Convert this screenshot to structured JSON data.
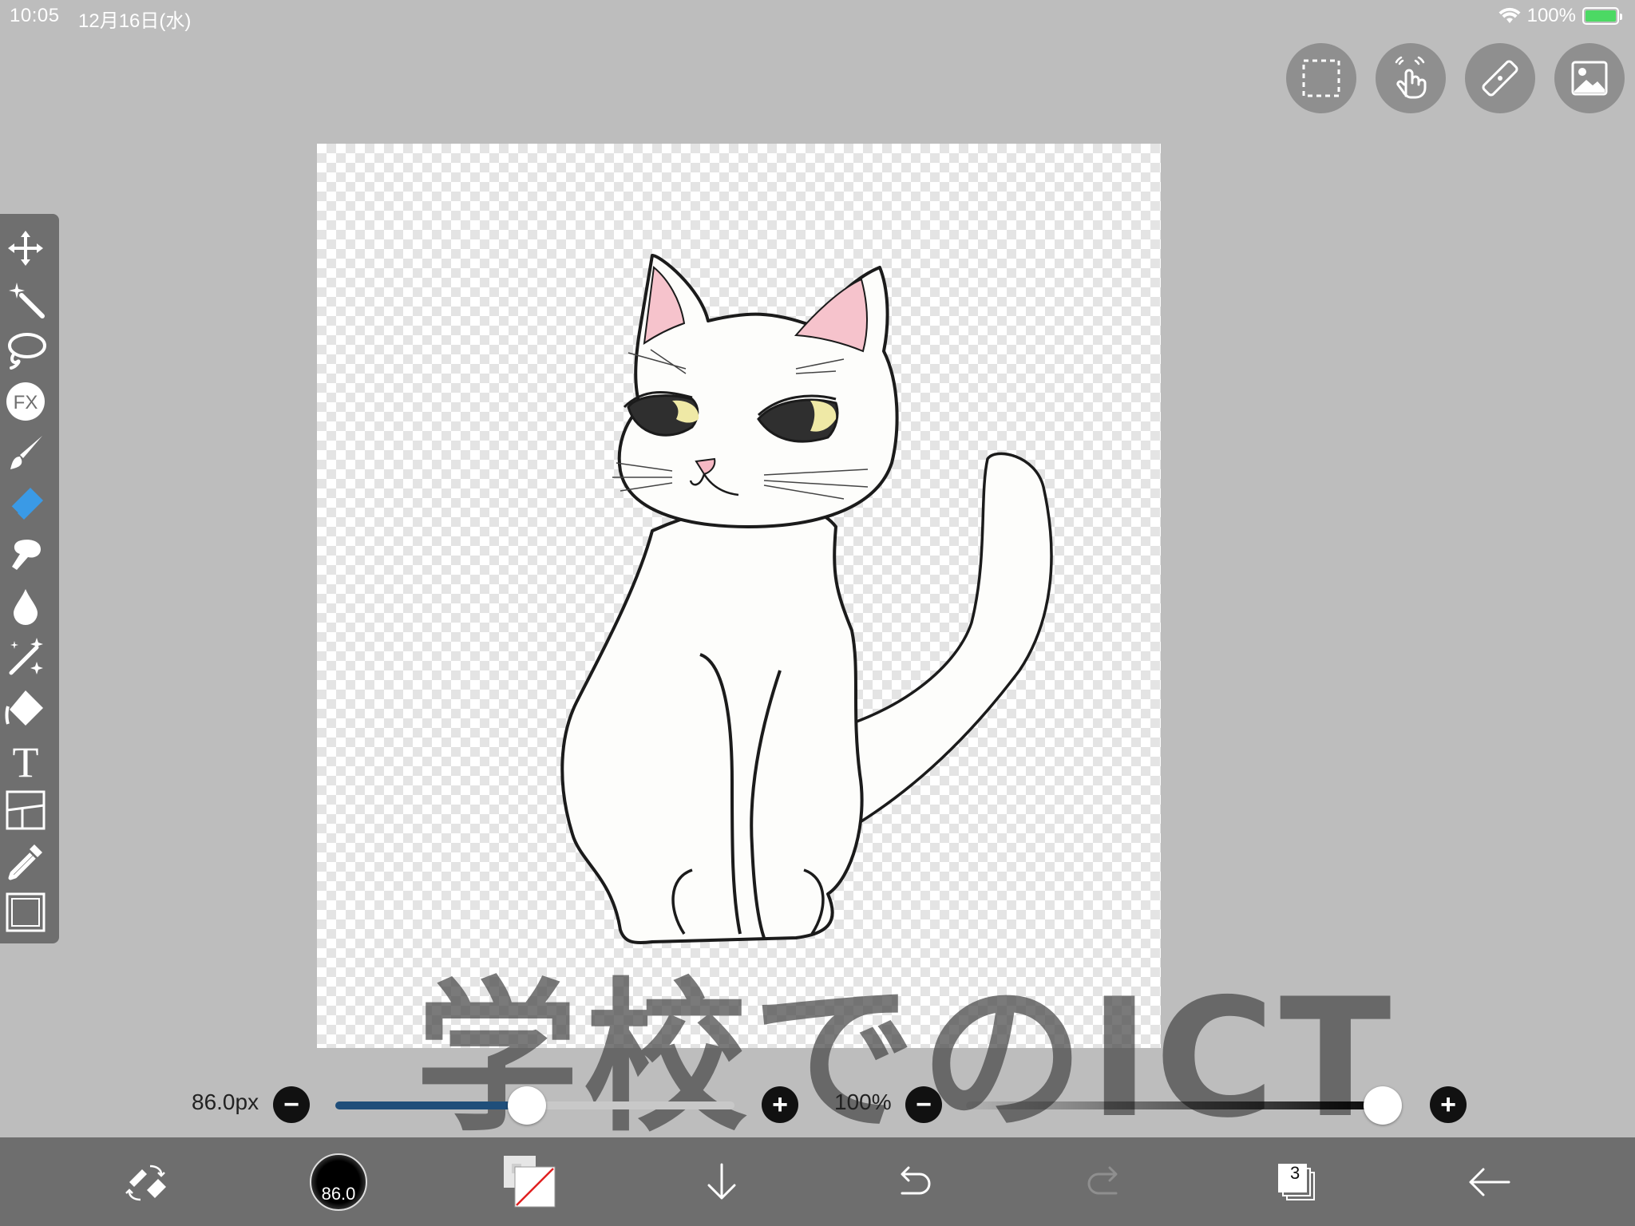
{
  "status_bar": {
    "time": "10:05",
    "date": "12月16日(水)",
    "battery": "100%",
    "icons": [
      "wifi-icon",
      "battery-charging-icon"
    ]
  },
  "top_actions": {
    "icons": [
      "selection-icon",
      "touch-gesture-icon",
      "ruler-icon",
      "image-reference-icon"
    ]
  },
  "tools": {
    "items": [
      {
        "name": "move-tool",
        "icon": "move-icon"
      },
      {
        "name": "magic-wand-tool",
        "icon": "magic-wand-icon"
      },
      {
        "name": "lasso-tool",
        "icon": "lasso-icon"
      },
      {
        "name": "filter-tool",
        "icon": "fx-icon",
        "label": "FX"
      },
      {
        "name": "brush-tool",
        "icon": "brush-icon"
      },
      {
        "name": "eraser-tool",
        "icon": "eraser-icon",
        "active": true
      },
      {
        "name": "smudge-tool",
        "icon": "smudge-icon"
      },
      {
        "name": "blur-tool",
        "icon": "drop-icon"
      },
      {
        "name": "sparkle-tool",
        "icon": "sparkle-icon"
      },
      {
        "name": "fill-tool",
        "icon": "bucket-icon"
      },
      {
        "name": "text-tool",
        "icon": "text-icon",
        "label": "T"
      },
      {
        "name": "frame-tool",
        "icon": "frame-divider-icon"
      },
      {
        "name": "eyedropper-tool",
        "icon": "eyedropper-icon"
      },
      {
        "name": "canvas-tool",
        "icon": "canvas-icon"
      }
    ],
    "active_color": "#3a9ae6"
  },
  "watermark": {
    "text": "学校でのICT"
  },
  "sliders": {
    "size_label": "86.0px",
    "size_value": 0.48,
    "opacity_label": "100%",
    "opacity_value": 1.0,
    "size_track_color": "#1f4e7a"
  },
  "bottom_bar": {
    "brush_size": "86.0",
    "layer_count": "3",
    "icons": [
      "swap-tool-icon",
      "brush-size-icon",
      "color-swatch-icon",
      "download-icon",
      "undo-icon",
      "redo-icon",
      "layers-icon",
      "back-icon"
    ]
  }
}
